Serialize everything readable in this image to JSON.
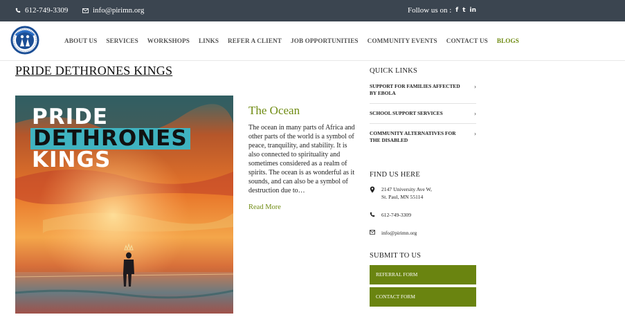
{
  "topbar": {
    "phone": "612-749-3309",
    "email": "info@pirimn.org",
    "follow_label": "Follow us on :",
    "social": [
      "f",
      "t",
      "in"
    ],
    "social_icons": [
      "facebook-icon",
      "twitter-icon",
      "linkedin-icon"
    ]
  },
  "nav": {
    "items": [
      "ABOUT US",
      "SERVICES",
      "WORKSHOPS",
      "LINKS",
      "REFER A CLIENT",
      "JOB OPPORTUNITIES",
      "COMMUNITY EVENTS",
      "CONTACT US",
      "BLOGS"
    ],
    "active": "BLOGS"
  },
  "post": {
    "title": "PRIDE DETHRONES KINGS",
    "image_text": [
      "PRIDE",
      "DETHRONES",
      "KINGS"
    ],
    "heading": "The Ocean",
    "excerpt": "The ocean in many parts of Africa and other parts of the world is a symbol of peace, tranquility, and stability. It is also connected to spirituality and sometimes considered as a realm of spirits. The ocean is as wonderful as it sounds, and can also be a symbol of destruction due to…",
    "read_more": "Read More"
  },
  "sidebar": {
    "quick_links_heading": "QUICK LINKS",
    "quick_links": [
      "SUPPORT FOR FAMILIES AFFECTED BY EBOLA",
      "SCHOOL SUPPORT SERVICES",
      "COMMUNITY ALTERNATIVES FOR THE DISABLED"
    ],
    "find_heading": "FIND US HERE",
    "address_line1": "2147 University Ave W,",
    "address_line2": "St. Paul, MN 55114",
    "phone": "612-749-3309",
    "email": "info@pirimn.org",
    "submit_heading": "SUBMIT TO US",
    "buttons": [
      "REFERRAL FORM",
      "CONTACT FORM"
    ]
  },
  "colors": {
    "topbar_bg": "#3b4550",
    "accent_green": "#6f8b12",
    "button_green": "#6a8410",
    "image_highlight": "#3fb3c0"
  }
}
